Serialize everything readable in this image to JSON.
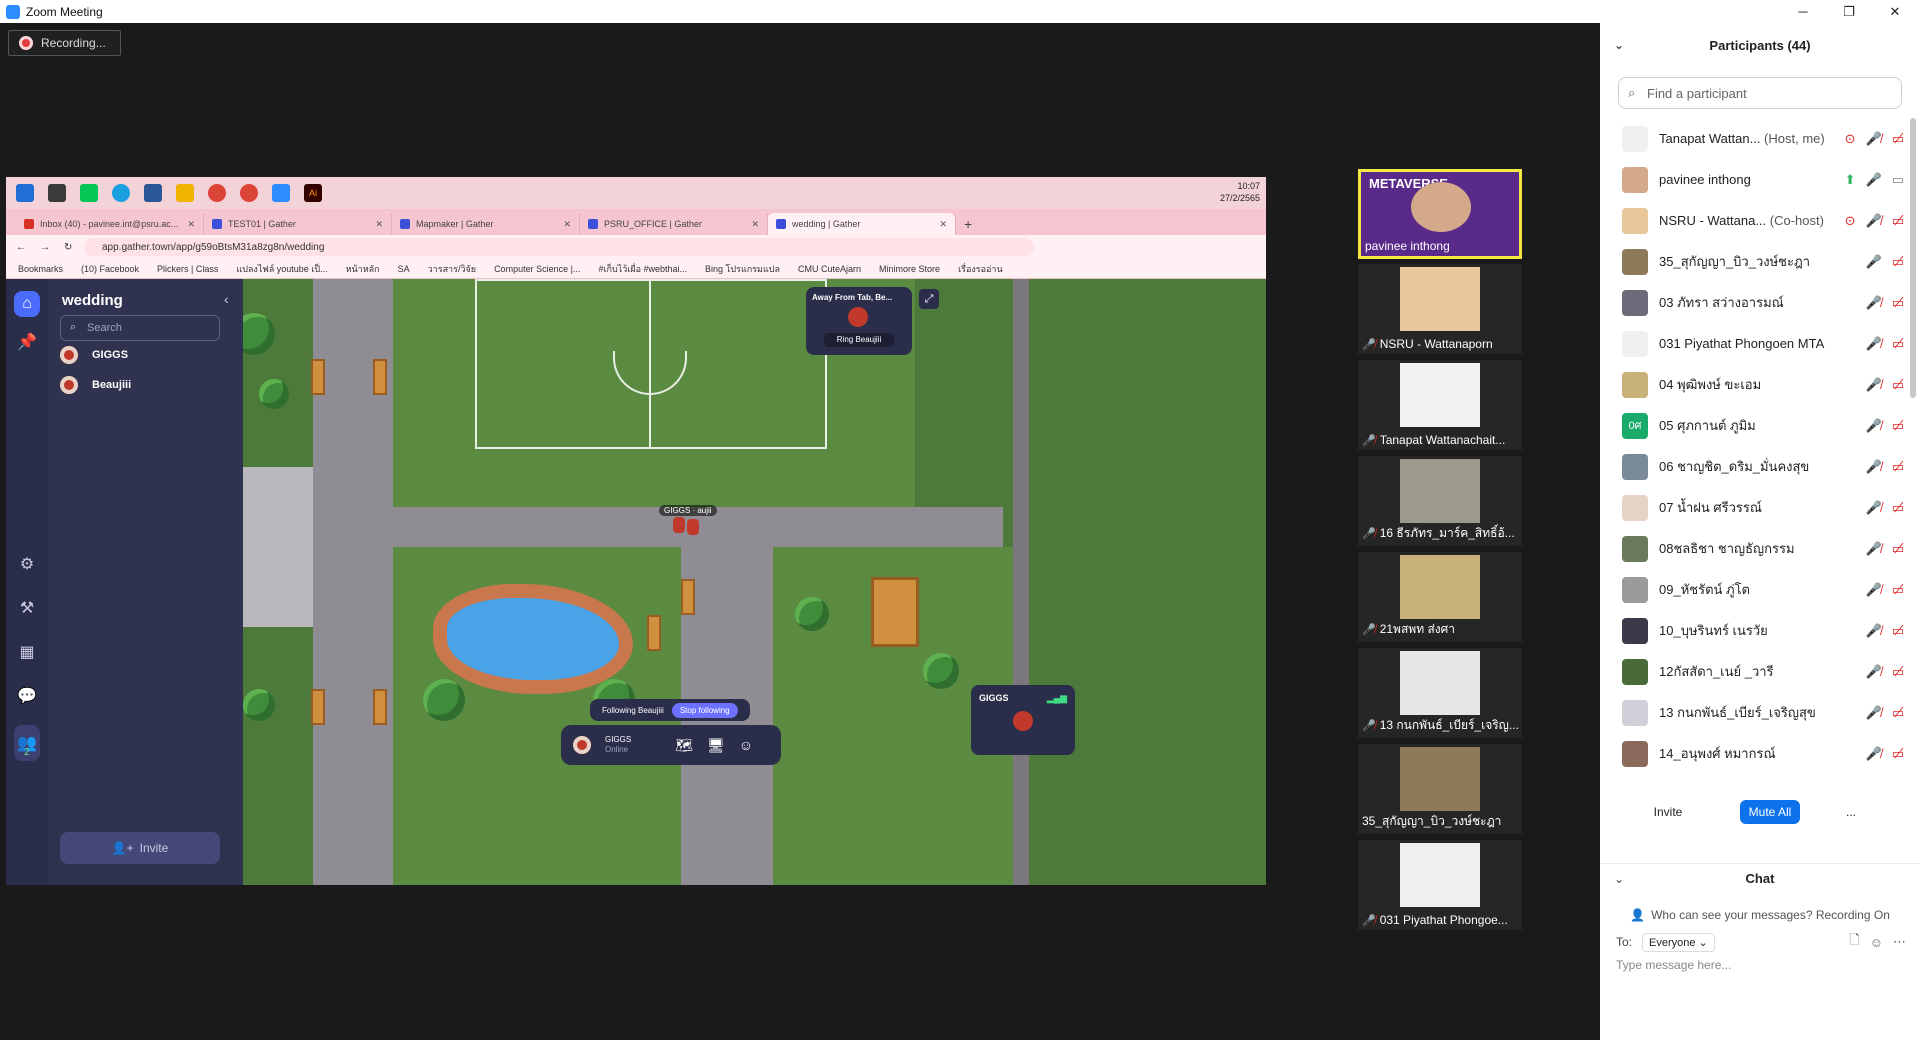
{
  "window": {
    "title": "Zoom Meeting",
    "minimize": "─",
    "restore": "❐",
    "close": "✕"
  },
  "recording": {
    "label": "Recording..."
  },
  "shared_screen": {
    "clock": {
      "time": "10:07",
      "date": "27/2/2565"
    },
    "tabs": [
      {
        "label": "Inbox (40) - pavinee.int@psru.ac...",
        "close": "✕"
      },
      {
        "label": "TEST01 | Gather",
        "close": "✕"
      },
      {
        "label": "Mapmaker | Gather",
        "close": "✕"
      },
      {
        "label": "PSRU_OFFICE | Gather",
        "close": "✕"
      },
      {
        "label": "wedding | Gather",
        "close": "✕"
      }
    ],
    "new_tab": "+",
    "url": "app.gather.town/app/g59oBtsM31a8zg8n/wedding",
    "bookmarks": [
      "Bookmarks",
      "(10) Facebook",
      "Plickers | Class",
      "แปลงไฟล์ youtube เป็...",
      "หน้าหลัก",
      "SA",
      "วารสาร/วิจัย",
      "Computer Science |...",
      "#เก็บไว้เผื่อ #webthai...",
      "Bing โปรแกรมแปล",
      "CMU CuteAjarn",
      "Minimore Store",
      "เรื่องรออ่าน"
    ],
    "gather": {
      "space_name": "wedding",
      "search_placeholder": "Search",
      "users": [
        "GIGGS",
        "Beaujiii"
      ],
      "online_count": "2",
      "invite": "Invite",
      "popup": {
        "status": "Away From Tab, Be...",
        "ring": "Ring Beaujiii"
      },
      "player_label": "GIGGS · aujii",
      "following": "Following Beaujiii",
      "stop_following": "Stop following",
      "self": {
        "name": "GIGGS",
        "status": "Online"
      },
      "mini_video_name": "GIGGS"
    }
  },
  "video_tiles": [
    {
      "name": "pavinee inthong",
      "banner": "METAVERSE",
      "muted": false
    },
    {
      "name": "NSRU - Wattanaporn",
      "muted": true
    },
    {
      "name": "Tanapat Wattanachait...",
      "muted": true
    },
    {
      "name": "16 ธีรภัทร_มาร์ค_สิทธิ์อ้...",
      "muted": true
    },
    {
      "name": "21พสพท ส่งศา",
      "muted": true
    },
    {
      "name": "13 กนกพันธ์_เบียร์_เจริญ...",
      "muted": true
    },
    {
      "name": "35_สุกัญญา_บิว_วงษ์ชะฎา",
      "muted": false
    },
    {
      "name": "031 Piyathat Phongoe...",
      "muted": true
    }
  ],
  "participants": {
    "title": "Participants (44)",
    "search_placeholder": "Find a participant",
    "list": [
      {
        "name": "Tanapat Wattan...",
        "role": "(Host, me)"
      },
      {
        "name": "pavinee inthong",
        "role": ""
      },
      {
        "name": "NSRU - Wattana...",
        "role": "(Co-host)"
      },
      {
        "name": "35_สุกัญญา_บิว_วงษ์ชะฎา",
        "role": ""
      },
      {
        "name": "03 ภัทรา สว่างอารมณ์",
        "role": ""
      },
      {
        "name": "031 Piyathat Phongoen MTA",
        "role": ""
      },
      {
        "name": "04 พุฒิพงษ์ ขะเอม",
        "role": ""
      },
      {
        "name": "05 ศุภกานต์ ภูมิม",
        "role": "",
        "initials": "0ศ"
      },
      {
        "name": "06 ชาญชิต_ดริม_มั่นคงสุข",
        "role": ""
      },
      {
        "name": "07 น้ำฝน ศรีวรรณ์",
        "role": ""
      },
      {
        "name": "08ชลธิชา ชาญธัญกรรม",
        "role": ""
      },
      {
        "name": "09_หัชรัตน์ ภู่โต",
        "role": ""
      },
      {
        "name": "10_บุษรินทร์ เนรวัย",
        "role": ""
      },
      {
        "name": "12กัสสัดา_เนย์ _วารี",
        "role": ""
      },
      {
        "name": "13 กนกพันธ์_เบียร์_เจริญสุข",
        "role": ""
      },
      {
        "name": "14_อนุพงศ์ หมากรณ์",
        "role": ""
      }
    ],
    "buttons": {
      "invite": "Invite",
      "mute_all": "Mute All",
      "more": "..."
    }
  },
  "chat": {
    "title": "Chat",
    "notice": "Who can see your messages? Recording On",
    "to_label": "To:",
    "to_value": "Everyone",
    "placeholder": "Type message here..."
  },
  "colors": {
    "accent": "#0e72ed",
    "muted_red": "#e02828",
    "gather_nav": "#2b2e4a",
    "highlight": "#f5e642"
  }
}
